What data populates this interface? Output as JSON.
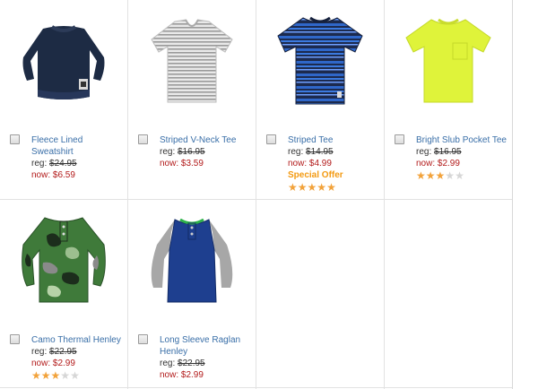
{
  "products": [
    {
      "name": "Fleece Lined Sweatshirt",
      "reg_label": "reg:",
      "reg_price": "$24.95",
      "now_label": "now:",
      "now_price": "$6.59",
      "offer": "",
      "rating": 0
    },
    {
      "name": "Striped V-Neck Tee",
      "reg_label": "reg:",
      "reg_price": "$16.95",
      "now_label": "now:",
      "now_price": "$3.59",
      "offer": "",
      "rating": 0
    },
    {
      "name": "Striped Tee",
      "reg_label": "reg:",
      "reg_price": "$14.95",
      "now_label": "now:",
      "now_price": "$4.99",
      "offer": "Special Offer",
      "rating": 5
    },
    {
      "name": "Bright Slub Pocket Tee",
      "reg_label": "reg:",
      "reg_price": "$16.95",
      "now_label": "now:",
      "now_price": "$2.99",
      "offer": "",
      "rating": 3
    },
    {
      "name": "Camo Thermal Henley",
      "reg_label": "reg:",
      "reg_price": "$22.95",
      "now_label": "now:",
      "now_price": "$2.99",
      "offer": "",
      "rating": 3
    },
    {
      "name": "Long Sleeve Raglan Henley",
      "reg_label": "reg:",
      "reg_price": "$22.95",
      "now_label": "now:",
      "now_price": "$2.99",
      "offer": "",
      "rating": 0
    }
  ],
  "colors": {
    "link": "#3a6fa8",
    "sale": "#b21a1a",
    "offer": "#f39a12",
    "star": "#f2a23a",
    "star_empty": "#d6d6d6"
  },
  "star_max": 5
}
